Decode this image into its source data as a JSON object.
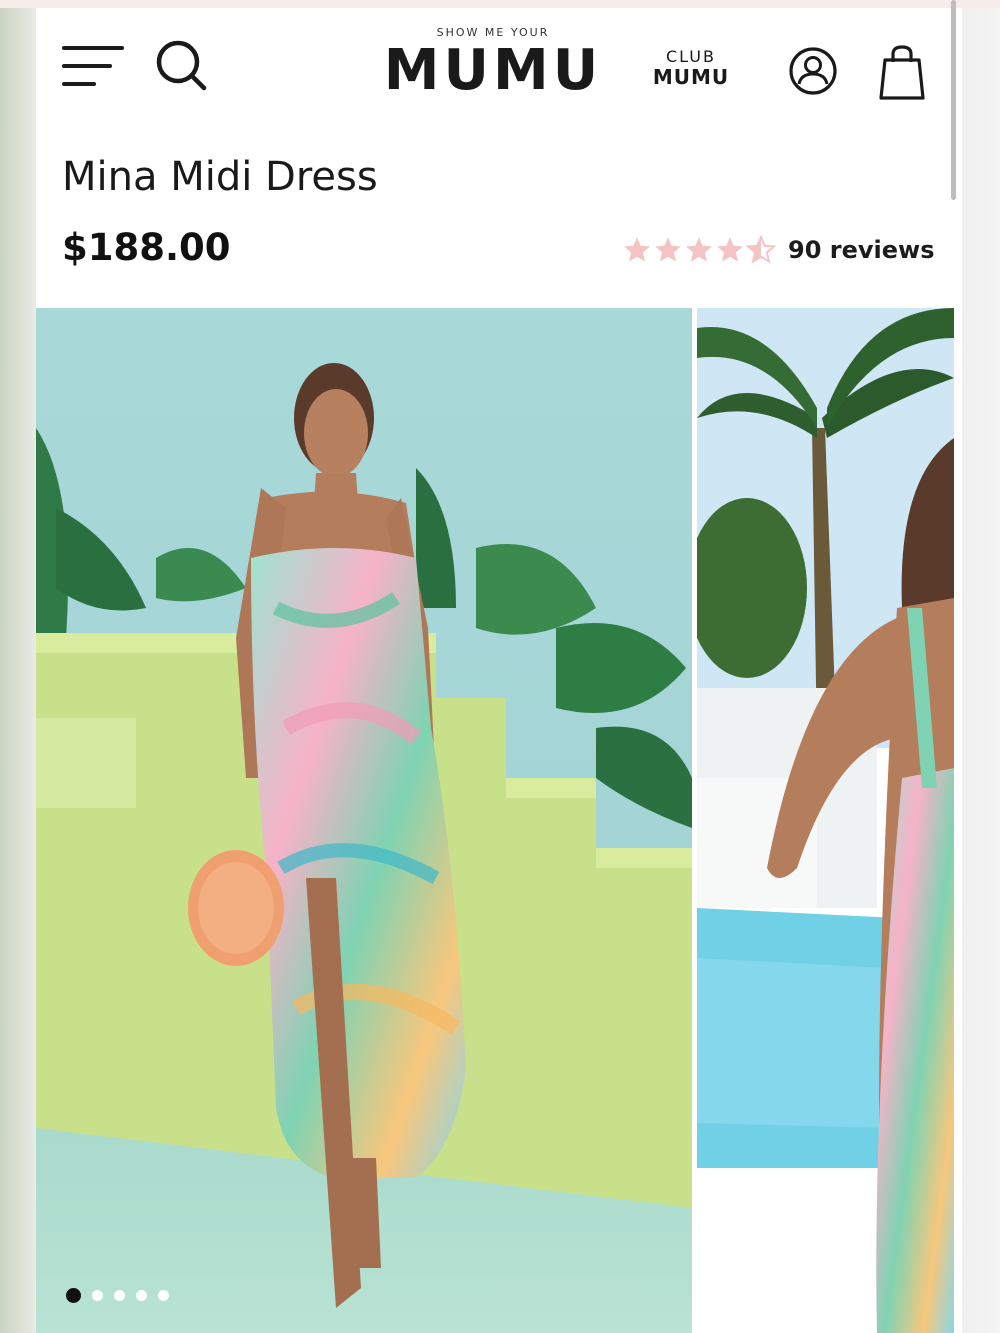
{
  "header": {
    "menu_icon": "hamburger-menu-icon",
    "search_icon": "search-icon",
    "logo_small": "SHOW ME YOUR",
    "logo_main": "MUMU",
    "club_top": "CLUB",
    "club_bottom": "MUMU",
    "account_icon": "user-account-icon",
    "cart_icon": "shopping-bag-icon"
  },
  "product": {
    "title": "Mina Midi Dress",
    "price": "$188.00",
    "rating": 4.5,
    "rating_max": 5,
    "reviews_label": "90 reviews",
    "star_color": "#f4c3c4"
  },
  "gallery": {
    "image_count": 5,
    "active_index": 0,
    "slides": [
      "product-photo-front",
      "product-photo-back"
    ]
  },
  "colors": {
    "text": "#1a1a1a",
    "background": "#ffffff",
    "star": "#f4c3c4"
  }
}
